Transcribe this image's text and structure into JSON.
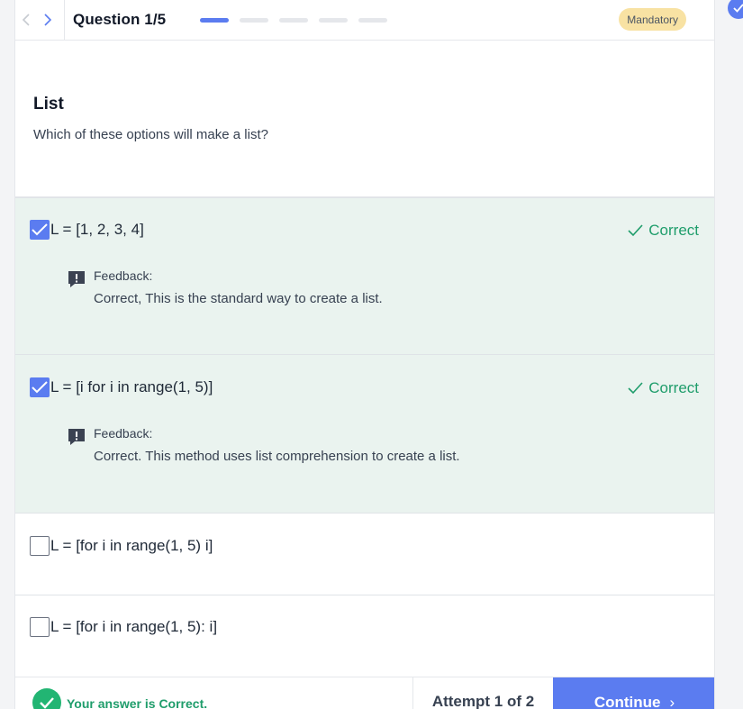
{
  "header": {
    "title": "Question 1/5",
    "progress": {
      "total": 5,
      "current": 1
    },
    "badge": "Mandatory"
  },
  "question": {
    "heading": "List",
    "text": "Which of these options will make a list?"
  },
  "options": [
    {
      "text": "L = [1, 2, 3, 4]",
      "checked": true,
      "status": "Correct",
      "feedback_label": "Feedback:",
      "feedback": "Correct, This is the standard way to create a list."
    },
    {
      "text": "L = [i for i in range(1, 5)]",
      "checked": true,
      "status": "Correct",
      "feedback_label": "Feedback:",
      "feedback": "Correct. This method uses list comprehension to create a list."
    },
    {
      "text": "L = [for i in  range(1, 5) i]",
      "checked": false
    },
    {
      "text": "L = [for i in range(1, 5): i]",
      "checked": false
    }
  ],
  "footer": {
    "status_message": "Your answer is Correct.",
    "attempt": "Attempt 1 of 2",
    "continue_label": "Continue"
  },
  "colors": {
    "accent": "#5b7cf0",
    "correct_green": "#1f9d6b",
    "correct_bg": "#eaf3ef",
    "badge_bg": "#f8e2a3"
  }
}
